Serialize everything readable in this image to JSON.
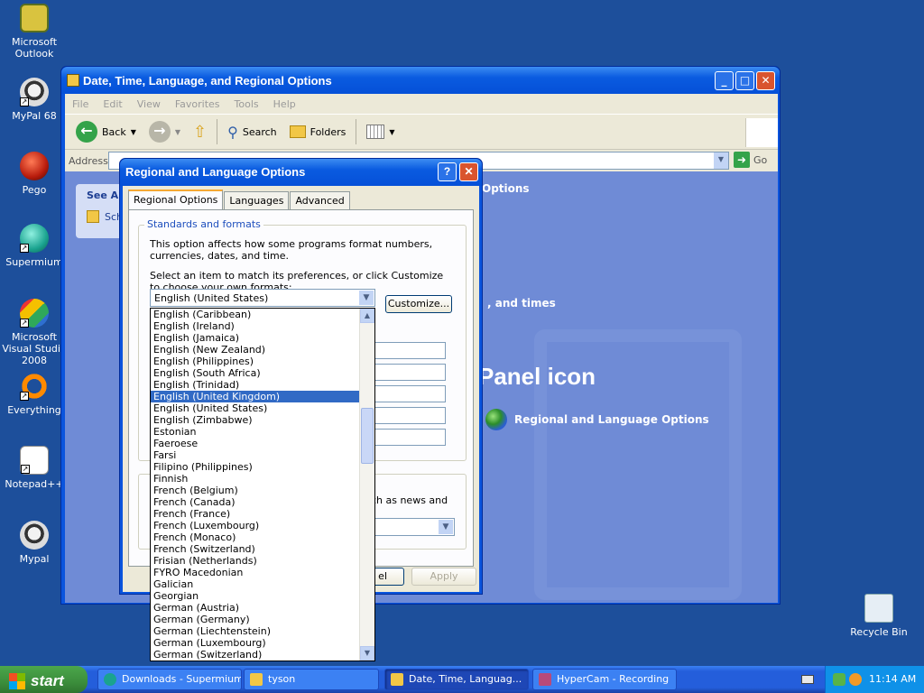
{
  "desktop": {
    "icons": [
      {
        "label": "Microsoft Outlook"
      },
      {
        "label": "MyPal 68"
      },
      {
        "label": "Pego"
      },
      {
        "label": "Supermium"
      },
      {
        "label": "Microsoft Visual Studio 2008"
      },
      {
        "label": "Everything"
      },
      {
        "label": "Notepad++"
      },
      {
        "label": "Mypal"
      },
      {
        "label": "Recycle Bin"
      }
    ]
  },
  "explorer": {
    "title": "Date, Time, Language, and Regional Options",
    "menu": [
      "File",
      "Edit",
      "View",
      "Favorites",
      "Tools",
      "Help"
    ],
    "toolbar": {
      "back": "Back",
      "search": "Search",
      "folders": "Folders"
    },
    "address_label": "Address",
    "go_label": "Go",
    "see_also": "See Also",
    "see_also_item": "Sch",
    "text_options": "Options",
    "text_times": ", and times",
    "panel_icon": "Panel icon",
    "cpl_link": "Regional and Language Options"
  },
  "dialog": {
    "title": "Regional and Language Options",
    "tabs": [
      "Regional Options",
      "Languages",
      "Advanced"
    ],
    "group_label": "Standards and formats",
    "desc1": "This option affects how some programs format numbers, currencies, dates, and time.",
    "desc2": "Select an item to match its preferences, or click Customize to choose your own formats:",
    "selected_format": "English (United States)",
    "customize_label": "Customize...",
    "partial_text": "uch as news and",
    "cancel_partial": "el",
    "apply_label": "Apply"
  },
  "dropdown": {
    "items": [
      "English (Caribbean)",
      "English (Ireland)",
      "English (Jamaica)",
      "English (New Zealand)",
      "English (Philippines)",
      "English (South Africa)",
      "English (Trinidad)",
      "English (United Kingdom)",
      "English (United States)",
      "English (Zimbabwe)",
      "Estonian",
      "Faeroese",
      "Farsi",
      "Filipino (Philippines)",
      "Finnish",
      "French (Belgium)",
      "French (Canada)",
      "French (France)",
      "French (Luxembourg)",
      "French (Monaco)",
      "French (Switzerland)",
      "Frisian (Netherlands)",
      "FYRO Macedonian",
      "Galician",
      "Georgian",
      "German (Austria)",
      "German (Germany)",
      "German (Liechtenstein)",
      "German (Luxembourg)",
      "German (Switzerland)"
    ],
    "highlighted": "English (United Kingdom)"
  },
  "taskbar": {
    "start": "start",
    "tasks": [
      "Downloads - Supermium",
      "tyson",
      "Date, Time, Languag...",
      "HyperCam - Recording"
    ],
    "clock": "11:14 AM"
  }
}
